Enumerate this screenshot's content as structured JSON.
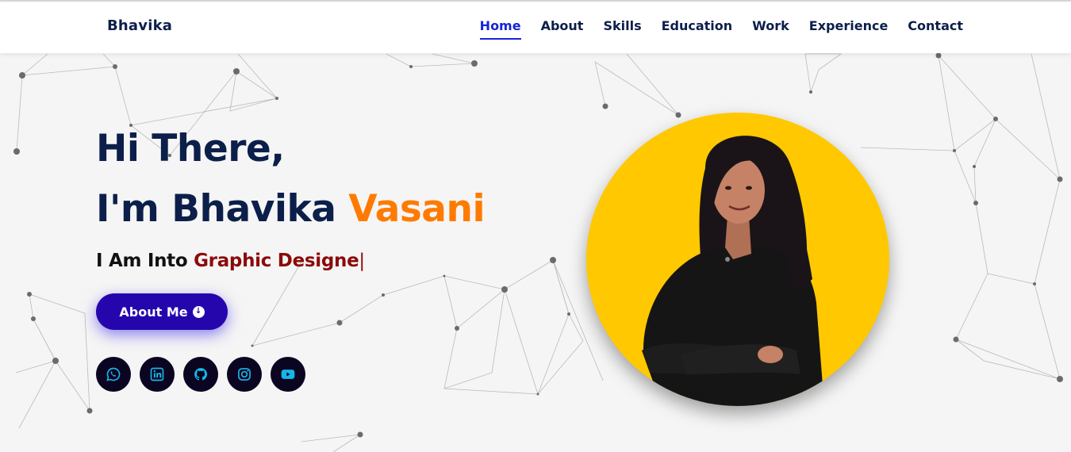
{
  "header": {
    "brand": "Bhavika",
    "nav": [
      "Home",
      "About",
      "Skills",
      "Education",
      "Work",
      "Experience",
      "Contact"
    ],
    "active": "Home"
  },
  "hero": {
    "greeting": "Hi There,",
    "intro": "I'm Bhavika ",
    "surname": "Vasani",
    "typed_prefix": "I Am Into ",
    "typed_role": "Graphic Designe",
    "caret": "|",
    "button_label": "About Me",
    "button_icon": "arrow-down-circle-icon"
  },
  "socials": [
    "whatsapp-icon",
    "linkedin-icon",
    "github-icon",
    "instagram-icon",
    "youtube-icon"
  ],
  "colors": {
    "brand_navy": "#0c1f4a",
    "accent_orange": "#ff7a00",
    "role_red": "#8c0a0a",
    "button_blue": "#2506ad",
    "nav_active": "#1525d6",
    "social_icon": "#16b6e8",
    "avatar_bg": "#ffc800"
  }
}
